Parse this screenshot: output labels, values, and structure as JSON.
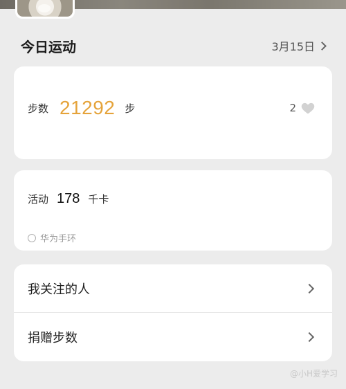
{
  "section": {
    "title": "今日运动",
    "date": "3月15日"
  },
  "steps": {
    "label": "步数",
    "value": "21292",
    "unit": "步",
    "likes": "2",
    "value_color": "#e5a33a"
  },
  "activity": {
    "label": "活动",
    "value": "178",
    "unit": "千卡",
    "device": "华为手环"
  },
  "list": {
    "items": [
      {
        "label": "我关注的人"
      },
      {
        "label": "捐赠步数"
      }
    ]
  },
  "watermark": {
    "text": "@小H爱学习"
  },
  "icons": {
    "date_chevron": "chevron-right-icon",
    "like": "heart-icon",
    "device": "circle-icon",
    "list_chevron": "chevron-right-icon"
  }
}
